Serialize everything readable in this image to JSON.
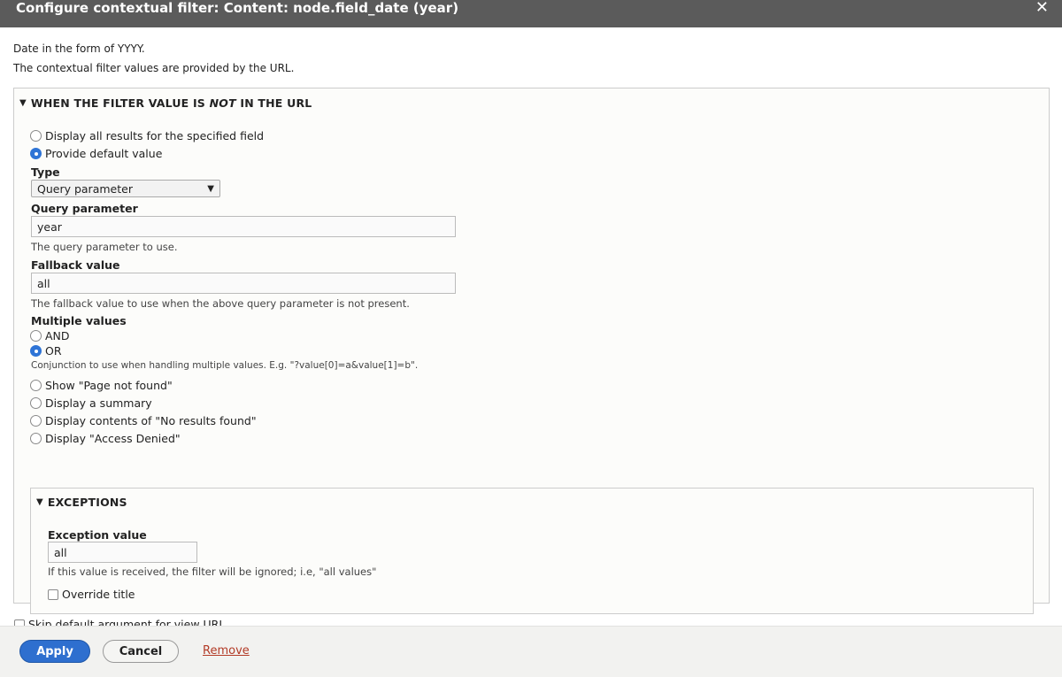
{
  "dialog": {
    "title": "Configure contextual filter: Content: node.field_date (year)",
    "close_glyph": "✕"
  },
  "descriptions": {
    "line1": "Date in the form of YYYY.",
    "line2": "The contextual filter values are provided by the URL."
  },
  "not_in_url_section": {
    "legend_prefix": "WHEN THE FILTER VALUE IS ",
    "legend_em": "NOT",
    "legend_suffix": " IN THE URL",
    "options": [
      {
        "label": "Display all results for the specified field",
        "checked": false
      },
      {
        "label": "Provide default value",
        "checked": true
      }
    ],
    "type": {
      "label": "Type",
      "selected": "Query parameter"
    },
    "query_parameter": {
      "label": "Query parameter",
      "value": "year",
      "help": "The query parameter to use."
    },
    "fallback_value": {
      "label": "Fallback value",
      "value": "all",
      "help": "The fallback value to use when the above query parameter is not present."
    },
    "multiple_values": {
      "label": "Multiple values",
      "options": [
        {
          "label": "AND",
          "checked": false
        },
        {
          "label": "OR",
          "checked": true
        }
      ],
      "help": "Conjunction to use when handling multiple values. E.g. \"?value[0]=a&value[1]=b\"."
    },
    "more_options": [
      {
        "label": "Show \"Page not found\"",
        "checked": false
      },
      {
        "label": "Display a summary",
        "checked": false
      },
      {
        "label": "Display contents of \"No results found\"",
        "checked": false
      },
      {
        "label": "Display \"Access Denied\"",
        "checked": false
      }
    ],
    "exceptions": {
      "legend": "EXCEPTIONS",
      "exception_value": {
        "label": "Exception value",
        "value": "all",
        "help": "If this value is received, the filter will be ignored; i.e, \"all values\""
      },
      "override_title": {
        "label": "Override title",
        "checked": false
      }
    }
  },
  "skip_default": {
    "label": "Skip default argument for view URL",
    "checked": false
  },
  "footer": {
    "apply_label": "Apply",
    "cancel_label": "Cancel",
    "remove_label": "Remove"
  }
}
